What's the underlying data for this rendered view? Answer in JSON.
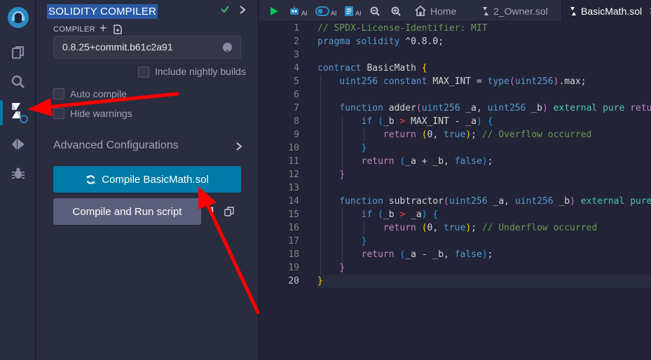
{
  "panel": {
    "title": "SOLIDITY COMPILER",
    "compiler_label": "COMPILER",
    "compiler_version": "0.8.25+commit.b61c2a91",
    "include_nightly_label": "Include nightly builds",
    "auto_compile_label": "Auto compile",
    "hide_warnings_label": "Hide warnings",
    "advanced_label": "Advanced Configurations",
    "compile_button_label": "Compile BasicMath.sol",
    "run_button_label": "Compile and Run script",
    "info_glyph": "i"
  },
  "tabs": {
    "ai_badge": "AI",
    "home_label": "Home",
    "owner_label": "2_Owner.sol",
    "basicmath_label": "BasicMath.sol",
    "close_glyph": "✕"
  },
  "editor": {
    "line_numbers": [
      "1",
      "2",
      "3",
      "4",
      "5",
      "6",
      "7",
      "8",
      "9",
      "10",
      "11",
      "12",
      "13",
      "14",
      "15",
      "16",
      "17",
      "18",
      "19",
      "20"
    ],
    "active_line": "20"
  },
  "colors": {
    "accent": "#007aa6",
    "title_highlight": "#2b5aa6",
    "annotation_arrow": "#ff0000",
    "run_tab_green": "#00c853",
    "check_green": "#3cbf6a"
  },
  "icons": {
    "rail": [
      "remix-logo-icon",
      "file-explorer-icon",
      "search-icon",
      "solidity-compiler-icon",
      "deploy-run-icon",
      "debugger-icon"
    ]
  }
}
